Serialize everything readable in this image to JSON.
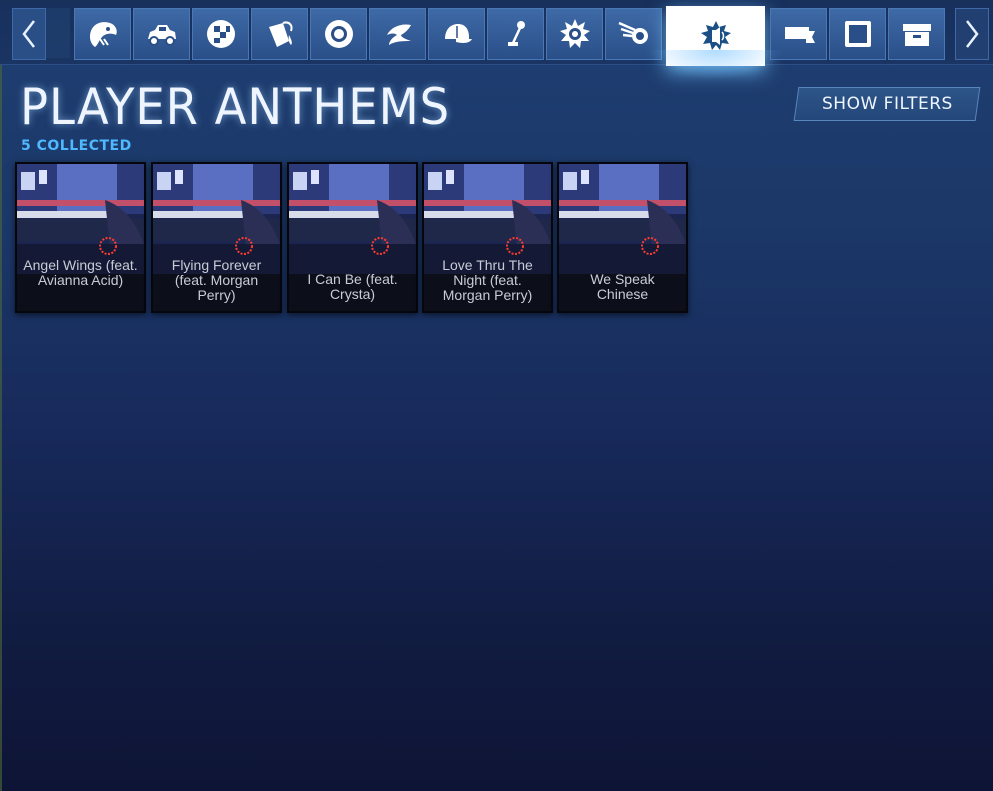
{
  "tabs": [
    {
      "icon": "decal-mascot-icon"
    },
    {
      "icon": "car-body-icon"
    },
    {
      "icon": "checkered-decal-icon"
    },
    {
      "icon": "paint-bucket-icon"
    },
    {
      "icon": "wheel-icon"
    },
    {
      "icon": "rocket-boost-icon"
    },
    {
      "icon": "topper-cap-icon"
    },
    {
      "icon": "antenna-icon"
    },
    {
      "icon": "goal-explosion-icon"
    },
    {
      "icon": "trail-icon"
    },
    {
      "icon": "player-anthem-icon",
      "active": true
    },
    {
      "icon": "banner-icon"
    },
    {
      "icon": "avatar-border-icon"
    },
    {
      "icon": "crate-icon"
    }
  ],
  "header": {
    "title": "PLAYER ANTHEMS",
    "collected_count": "5",
    "collected_label": "COLLECTED",
    "show_filters_label": "SHOW FILTERS"
  },
  "items": [
    {
      "title": "Angel Wings (feat. Avianna Acid)"
    },
    {
      "title": "Flying Forever (feat. Morgan Perry)"
    },
    {
      "title": "I Can Be (feat. Crysta)"
    },
    {
      "title": "Love Thru The Night (feat. Morgan Perry)"
    },
    {
      "title": "We Speak Chinese"
    }
  ],
  "colors": {
    "accent": "#4fb8ff",
    "tab_fill": "#3e6aa6",
    "active_tab": "#ffffff",
    "background_top": "#1f3f73",
    "background_bottom": "#0e1435"
  }
}
